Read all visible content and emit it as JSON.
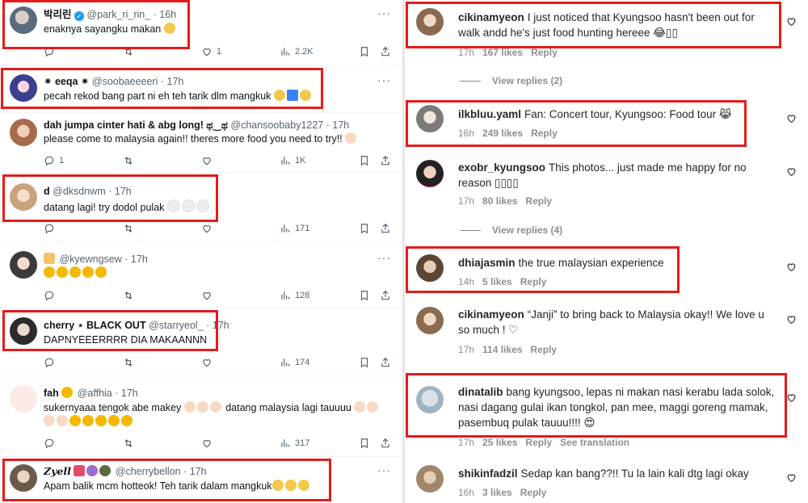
{
  "twitter": {
    "tweets": [
      {
        "name": "박리린",
        "verified": true,
        "handle": "@park_ri_rin_",
        "time": "· 16h",
        "text": "enaknya sayangku makan",
        "emoji": [
          "#f2c94c"
        ],
        "actions": {
          "reply": "",
          "retweet": "",
          "like": "1",
          "views": "2.2K"
        }
      },
      {
        "name": "✷ eeqa ✷",
        "verified": false,
        "handle": "@soobaeeeeri",
        "time": "· 17h",
        "text": "pecah rekod bang part ni eh teh tarik dlm mangkuk",
        "emoji": [
          "#f2c94c",
          "#3b82f6",
          "#f2c94c"
        ],
        "actions": {
          "reply": "",
          "retweet": "",
          "like": "",
          "views": ""
        }
      },
      {
        "name": "dah jumpa cinter hati & abg long! ಥ‿ಥ",
        "verified": false,
        "handle": "@chansoobaby1227",
        "time": "· 17h",
        "text": "please come to malaysia again!! theres more food you need to try!!",
        "emoji": [
          "#f7d9c4"
        ],
        "actions": {
          "reply": "1",
          "retweet": "",
          "like": "",
          "views": "1K"
        }
      },
      {
        "name": "d",
        "verified": false,
        "handle": "@dksdnwm",
        "time": "· 17h",
        "text": "datang lagi! try dodol pulak",
        "emoji": [
          "#eeeeee",
          "#eeeeee",
          "#eeeeee"
        ],
        "actions": {
          "reply": "",
          "retweet": "",
          "like": "",
          "views": "171"
        }
      },
      {
        "name": "",
        "verified": false,
        "handle": "@kyewngsew",
        "time": "· 17h",
        "text": "",
        "emoji": [
          "#f5b700",
          "#f5b700",
          "#f5b700",
          "#f5b700",
          "#f5b700"
        ],
        "actions": {
          "reply": "",
          "retweet": "",
          "like": "",
          "views": "128"
        }
      },
      {
        "name": "cherry ⋆ BLACK OUT",
        "verified": false,
        "handle": "@starryeol_",
        "time": "· 17h",
        "text": "DAPNYEEERRRR DIA MAKAANNN",
        "emoji": [],
        "actions": {
          "reply": "",
          "retweet": "",
          "like": "",
          "views": "174"
        }
      },
      {
        "name": "fah",
        "verified": false,
        "handle": "@affhia",
        "time": "· 17h",
        "text": "sukernyaaa tengok abe makey",
        "text2": "datang malaysia lagi tauuuu",
        "emoji": [
          "#f7d9c4",
          "#f7d9c4",
          "#f5b700",
          "#f5b700",
          "#f5b700",
          "#f5b700",
          "#f5b700"
        ],
        "actions": {
          "reply": "",
          "retweet": "",
          "like": "",
          "views": "317"
        }
      },
      {
        "name": "Zyell",
        "verified": false,
        "handle": "@cherrybellon",
        "time": "· 17h",
        "text": "Apam balik mcm hotteok! Teh tarik dalam mangkuk",
        "emoji": [
          "#f2c94c",
          "#f2c94c",
          "#f2c94c"
        ],
        "actions": {
          "reply": "",
          "retweet": "",
          "like": "",
          "views": ""
        }
      }
    ]
  },
  "instagram": {
    "comments": [
      {
        "user": "cikinamyeon",
        "text": "I just noticed that Kyungsoo hasn't been out for walk andd he's just food hunting hereee 😂▯▯",
        "time": "17h",
        "likes": "167 likes",
        "reply": "Reply",
        "view_replies": "View replies (2)"
      },
      {
        "user": "ilkbluu.yaml",
        "text": "Fan: Concert tour, Kyungsoo: Food tour 😹",
        "time": "16h",
        "likes": "249 likes",
        "reply": "Reply",
        "view_replies": ""
      },
      {
        "user": "exobr_kyungsoo",
        "text": "This photos... just made me happy for no reason ▯▯▯▯",
        "time": "17h",
        "likes": "80 likes",
        "reply": "Reply",
        "view_replies": "View replies (4)"
      },
      {
        "user": "dhiajasmin",
        "text": "the true malaysian experience",
        "time": "14h",
        "likes": "5 likes",
        "reply": "Reply",
        "view_replies": ""
      },
      {
        "user": "cikinamyeon",
        "text": "“Janji” to bring back to Malaysia okay!! We love u so much ! ♡",
        "time": "17h",
        "likes": "114 likes",
        "reply": "Reply",
        "view_replies": ""
      },
      {
        "user": "dinatalib",
        "text": "bang kyungsoo, lepas ni makan nasi kerabu lada solok, nasi dagang gulai ikan tongkol, pan mee, maggi goreng mamak, pasembuq pulak tauuu!!!! 😍",
        "time": "17h",
        "likes": "25 likes",
        "reply": "Reply",
        "translate": "See translation",
        "view_replies": ""
      },
      {
        "user": "shikinfadzil",
        "text": "Sedap kan bang??!! Tu la lain kali dtg lagi okay",
        "time": "16h",
        "likes": "3 likes",
        "reply": "Reply",
        "view_replies": ""
      }
    ]
  },
  "colors": {
    "highlight": "#e51b1b",
    "twitter_muted": "#536471",
    "ig_muted": "#8e8e8e",
    "verified": "#1d9bf0"
  }
}
